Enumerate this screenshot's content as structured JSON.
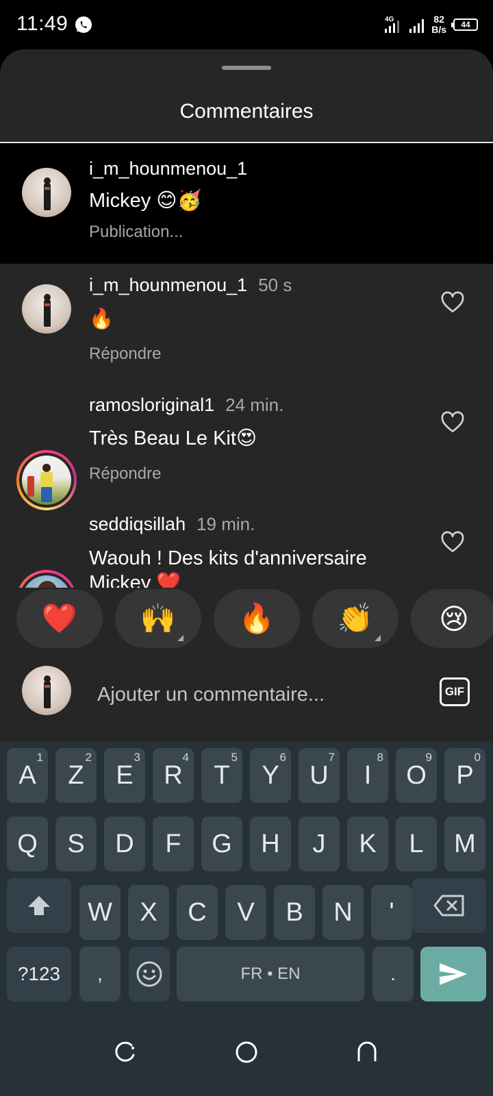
{
  "status_bar": {
    "time": "11:49",
    "network": "4G",
    "speed_value": "82",
    "speed_unit": "B/s",
    "battery": "44"
  },
  "sheet": {
    "title": "Commentaires"
  },
  "caption": {
    "username": "i_m_hounmenou_1",
    "text": "Mickey 😊🥳",
    "status": "Publication..."
  },
  "comments": [
    {
      "username": "i_m_hounmenou_1",
      "time": "50 s",
      "text": "🔥",
      "reply": "Répondre"
    },
    {
      "username": "ramosloriginal1",
      "time": "24 min.",
      "text": "Très Beau Le Kit😍",
      "reply": "Répondre"
    },
    {
      "username": "seddiqsillah",
      "time": "19 min.",
      "text": "Waouh ! Des kits d'anniversaire Mickey ❤️"
    }
  ],
  "reactions": [
    "❤️",
    "🙌",
    "🔥",
    "👏",
    "😢"
  ],
  "input": {
    "placeholder": "Ajouter un commentaire...",
    "gif_label": "GIF"
  },
  "keyboard": {
    "row1": [
      {
        "k": "A",
        "n": "1"
      },
      {
        "k": "Z",
        "n": "2"
      },
      {
        "k": "E",
        "n": "3"
      },
      {
        "k": "R",
        "n": "4"
      },
      {
        "k": "T",
        "n": "5"
      },
      {
        "k": "Y",
        "n": "6"
      },
      {
        "k": "U",
        "n": "7"
      },
      {
        "k": "I",
        "n": "8"
      },
      {
        "k": "O",
        "n": "9"
      },
      {
        "k": "P",
        "n": "0"
      }
    ],
    "row2": [
      "Q",
      "S",
      "D",
      "F",
      "G",
      "H",
      "J",
      "K",
      "L",
      "M"
    ],
    "row3": [
      "W",
      "X",
      "C",
      "V",
      "B",
      "N",
      "'"
    ],
    "symbols_label": "?123",
    "comma": ",",
    "space_label": "FR • EN",
    "period": "."
  },
  "colors": {
    "sheet_bg": "#262626",
    "keyboard_bg": "#263238",
    "send_key": "#6aaca3",
    "heart_red": "#e0122c"
  }
}
